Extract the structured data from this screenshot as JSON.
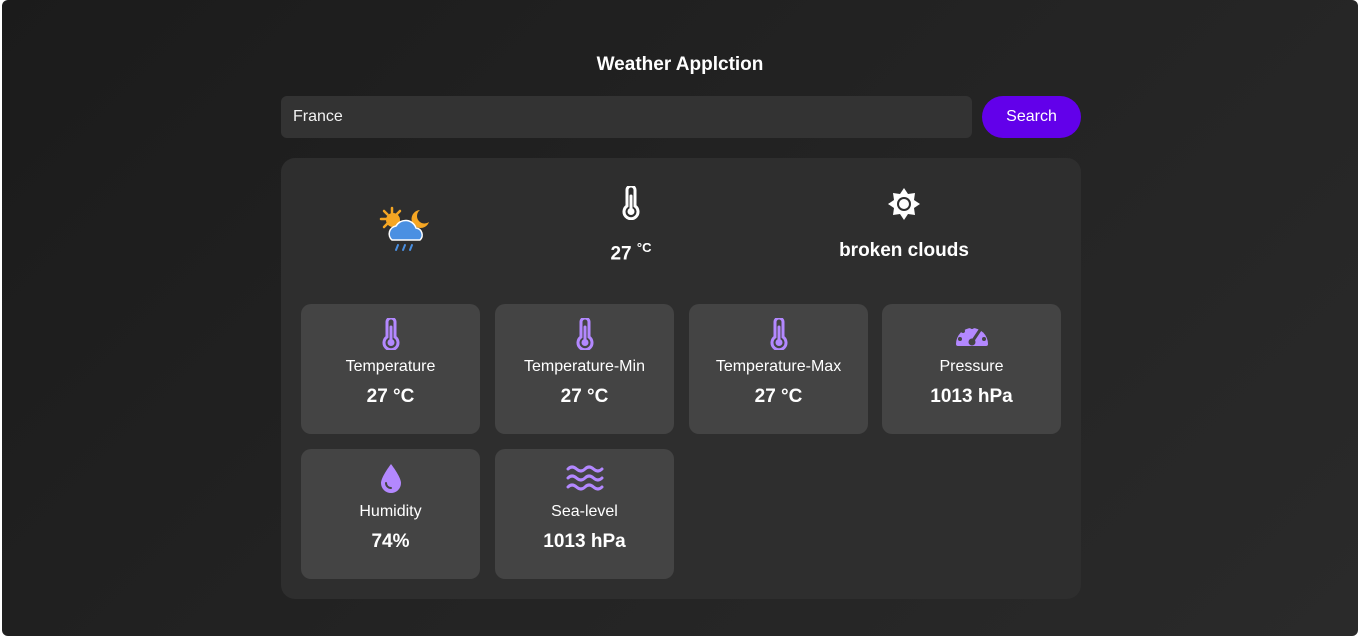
{
  "app": {
    "title": "Weather Applction"
  },
  "search": {
    "value": "France",
    "button_label": "Search"
  },
  "summary": {
    "temperature": "27 ",
    "temperature_unit": "°C",
    "description": "broken clouds",
    "icons": [
      "weather-condition-icon",
      "thermometer-icon",
      "sun-icon"
    ]
  },
  "colors": {
    "accent": "#6200ea",
    "icon_purple": "#b388ff",
    "card_bg": "#2e2e2e",
    "tile_bg": "#444444"
  },
  "tiles": [
    {
      "label": "Temperature",
      "value": "27 °C",
      "icon": "thermometer-icon"
    },
    {
      "label": "Temperature-Min",
      "value": "27 °C",
      "icon": "thermometer-icon"
    },
    {
      "label": "Temperature-Max",
      "value": "27 °C",
      "icon": "thermometer-icon"
    },
    {
      "label": "Pressure",
      "value": "1013 hPa",
      "icon": "gauge-icon"
    },
    {
      "label": "Humidity",
      "value": "74%",
      "icon": "droplet-icon"
    },
    {
      "label": "Sea-level",
      "value": "1013 hPa",
      "icon": "waves-icon"
    }
  ]
}
